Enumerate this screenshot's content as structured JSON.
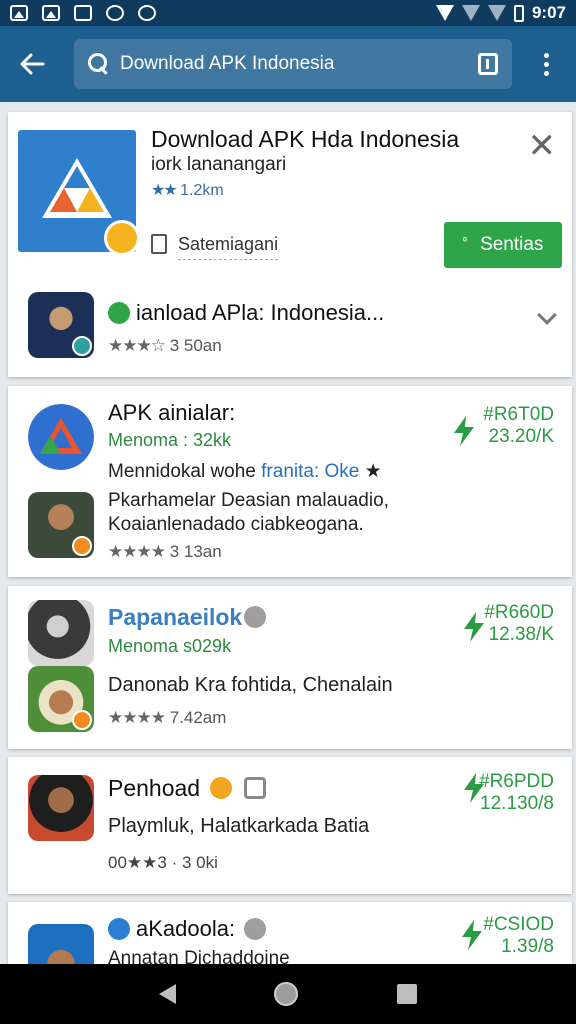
{
  "status_bar": {
    "time": "9:07"
  },
  "app_bar": {
    "search_query": "Download APK Indonesia"
  },
  "top_app": {
    "title": "Download APK Hda  Indonesia",
    "subtitle": "iork lananangari",
    "rating_stars": "★★",
    "rating_text": "1.2km",
    "meta": "Satemiagani",
    "install_label": "Sentias"
  },
  "related": {
    "title": "ianload APla: Indonesia...",
    "stars": "★★★☆",
    "rating": "3 50an"
  },
  "list": [
    {
      "title": "APK ainialar:",
      "sub": "Menoma : 32kk",
      "line1_a": "Mennidokal wohe ",
      "line1_b": "franita: Oke",
      "line1_c": " ★",
      "desc1": "Pkarhamelar Deasian malauadio,",
      "desc2": "Koaianlenadado ciabkeogana.",
      "stars": "★★★★",
      "rating": "3 13an",
      "price": "#R6T0D",
      "price_sub": "23.20/K"
    },
    {
      "title": "Papanaeilok",
      "sub": "Menoma s029k",
      "desc": "Danonab Kra fohtida, Chenalain",
      "stars": "★★★★",
      "rating": "7.42am",
      "price": "#R660D",
      "price_sub": "12.38/K"
    },
    {
      "title": "Penhoad",
      "desc": "Playmluk, Halatkarkada Batia",
      "rating_text": "00★★3 · 3 0ki",
      "price": "#R6PDD",
      "price_sub": "12.130/8"
    },
    {
      "title": "aKadoola:",
      "desc": "Annatan Dichaddoine",
      "price": "#CSIOD",
      "price_sub": "1.39/8"
    }
  ],
  "colors": {
    "status_bar": "#0f3c5e",
    "app_bar": "#1d5f8f",
    "install_green": "#2fa549",
    "price_green": "#2b9b44",
    "link_blue": "#3a7fbf"
  },
  "icons": [
    "image-icon",
    "gallery-icon",
    "mute-icon",
    "shield-icon",
    "gear-icon",
    "wifi-icon",
    "signal-icon",
    "battery-icon",
    "back-arrow-icon",
    "search-icon",
    "book-icon",
    "more-vert-icon",
    "close-icon",
    "clipboard-icon",
    "chevron-down-icon",
    "bolt-icon",
    "verified-badge-icon"
  ]
}
